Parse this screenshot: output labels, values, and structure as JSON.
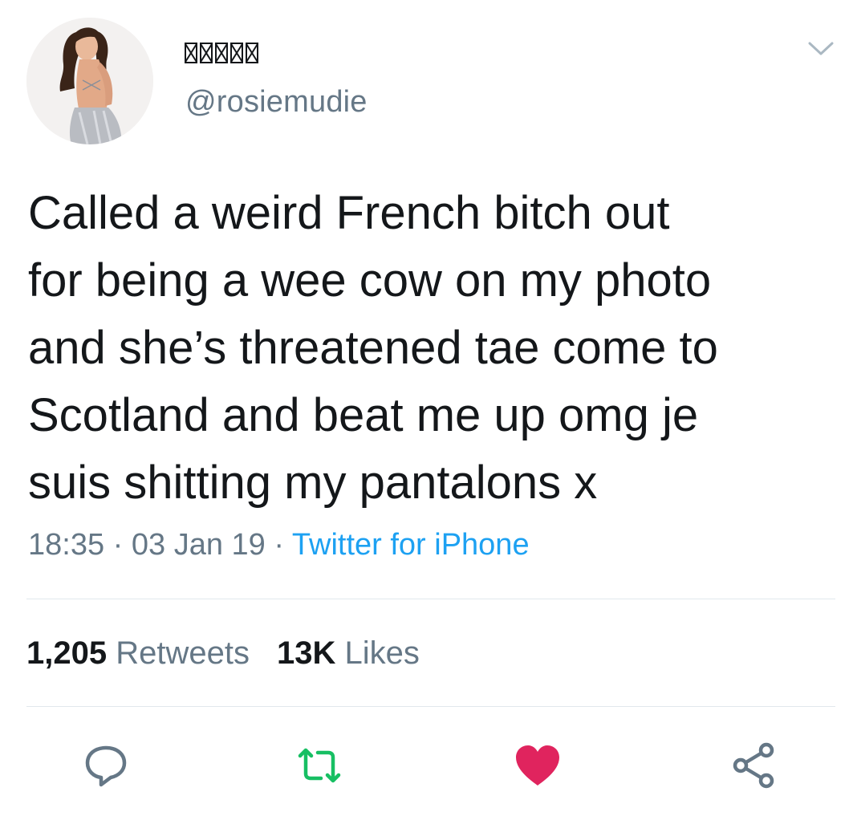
{
  "tweet": {
    "display_name_glyphs": [
      "box",
      "box",
      "box",
      "box",
      "box"
    ],
    "handle": "@rosiemudie",
    "text_lines": [
      "Called a weird French bitch out",
      "for being a wee cow on my photo",
      "and she’s threatened tae come to",
      "Scotland and beat me up omg je",
      "suis shitting my pantalons x"
    ],
    "time": "18:35",
    "date": "03 Jan 19",
    "separator": " · ",
    "source": "Twitter for iPhone"
  },
  "stats": {
    "retweets_count": "1,205",
    "retweets_label": "Retweets",
    "likes_count": "13K",
    "likes_label": "Likes"
  },
  "actions": {
    "reply_icon": "reply-icon",
    "retweet_icon": "retweet-icon",
    "like_icon": "heart-icon",
    "share_icon": "share-icon",
    "retweet_color": "#17bf63",
    "like_color": "#e0245e",
    "icon_color": "#657786"
  },
  "colors": {
    "text": "#14171a",
    "muted": "#657786",
    "link": "#1da1f2",
    "divider": "#e1e8ed"
  }
}
